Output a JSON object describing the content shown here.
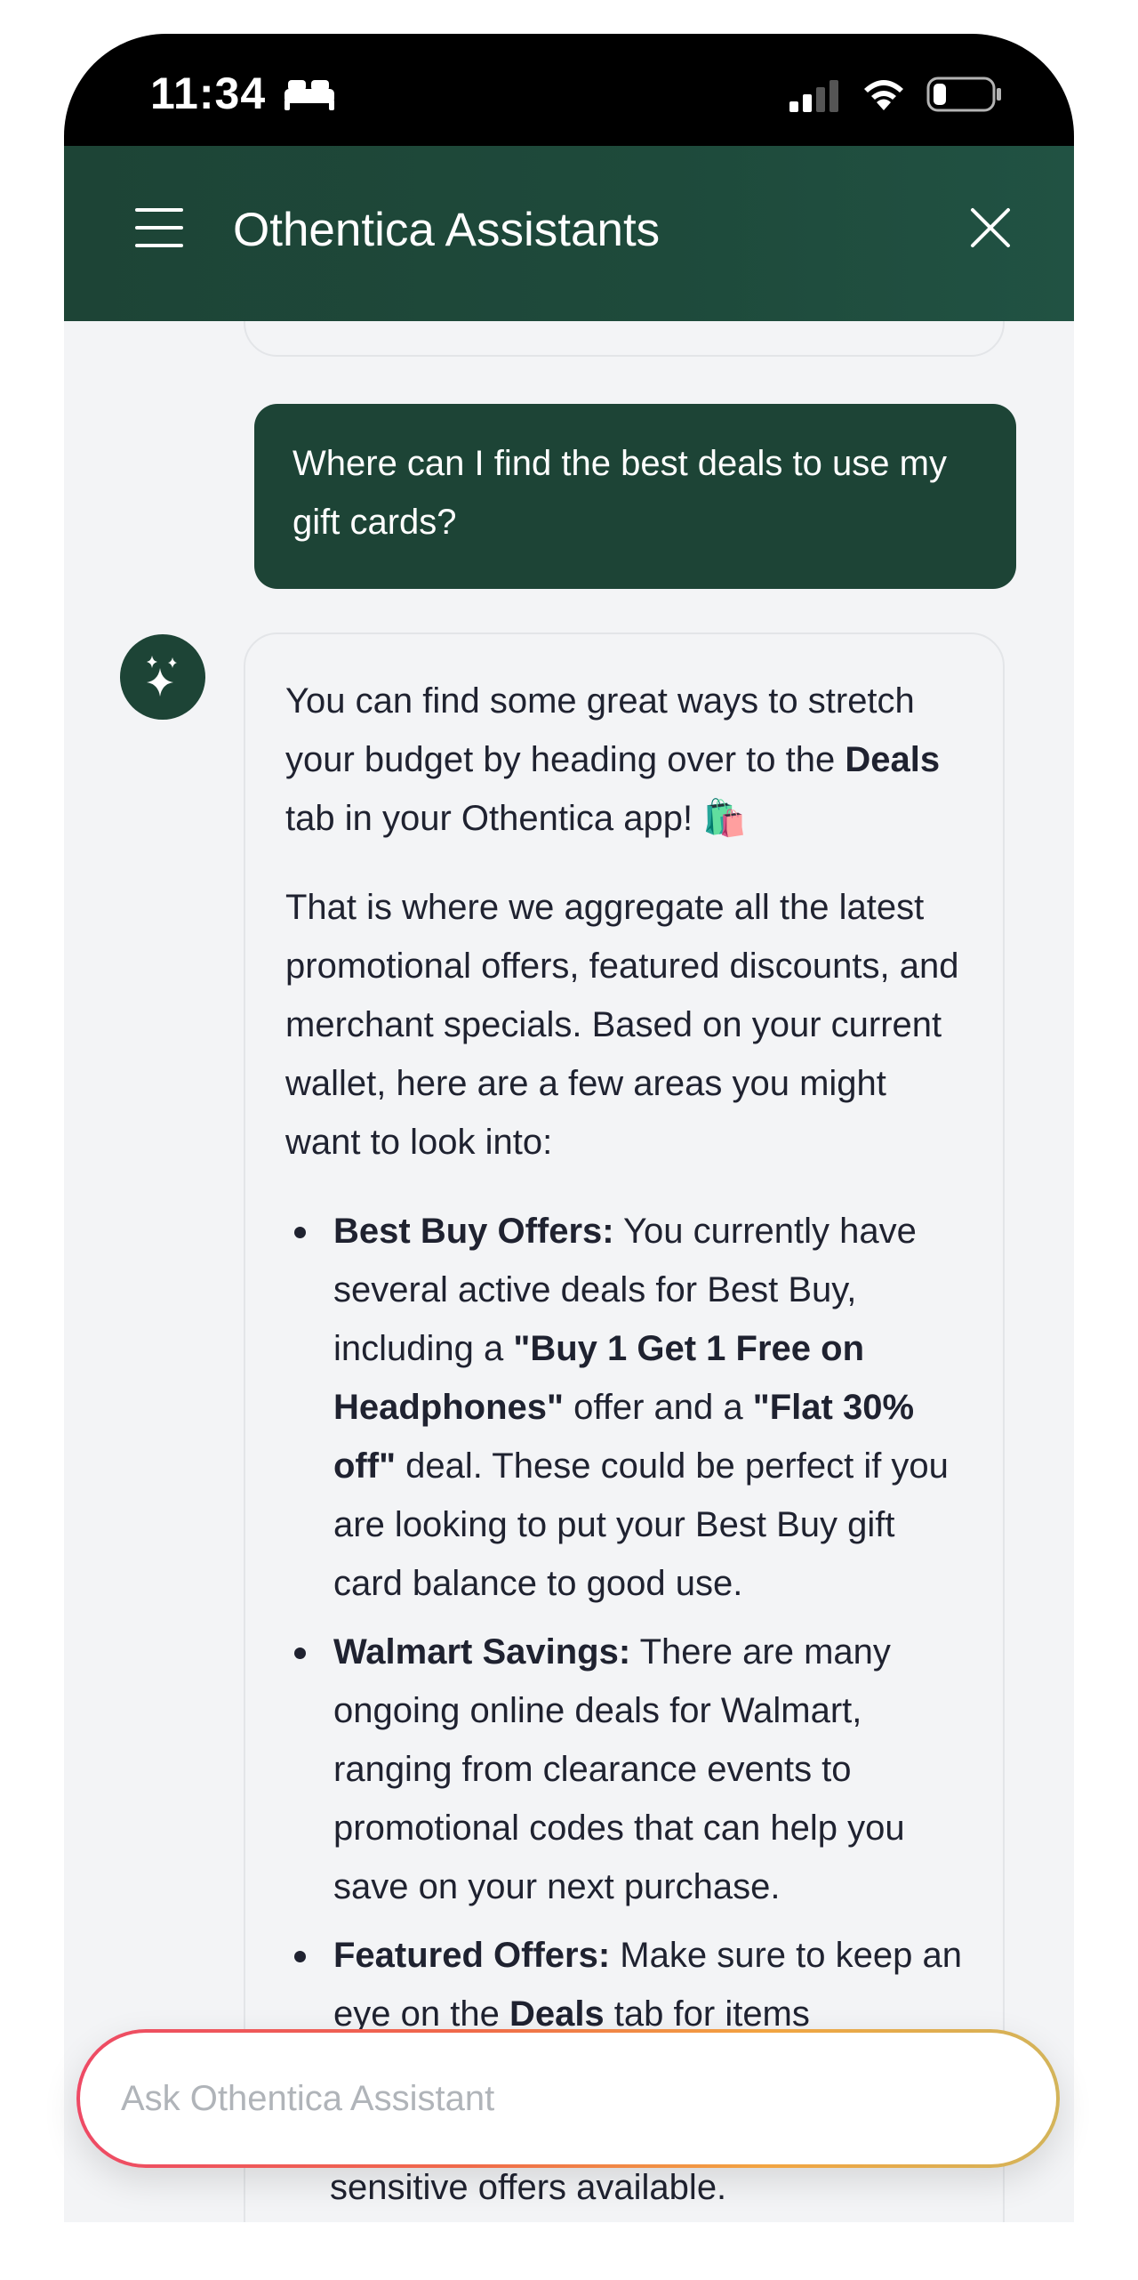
{
  "status_bar": {
    "time": "11:34",
    "icons": [
      "bed-icon",
      "signal-icon",
      "wifi-icon",
      "battery-icon"
    ]
  },
  "header": {
    "title": "Othentica Assistants",
    "menu_icon": "hamburger-menu-icon",
    "close_icon": "close-icon"
  },
  "colors": {
    "brand_green": "#1d4436",
    "bubble_bg": "#f3f4f6",
    "input_gradient_start": "#ee4a65",
    "input_gradient_end": "#d3b45a"
  },
  "messages": {
    "user": {
      "text": "Where can I find the best deals to use my gift cards?"
    },
    "assistant": {
      "avatar_icon": "sparkles-icon",
      "intro_part1": "You can find some great ways to stretch your budget by heading over to the ",
      "intro_bold": "Deals",
      "intro_part2": " tab in your Othentica app! ",
      "intro_emoji": "🛍️",
      "paragraph2": "That is where we aggregate all the latest promotional offers, featured discounts, and merchant specials. Based on your current wallet, here are a few areas you might want to look into:",
      "items": [
        {
          "title": "Best Buy Offers:",
          "text1": " You currently have several active deals for Best Buy, including a ",
          "bold1": "\"Buy 1 Get 1 Free on Headphones\"",
          "text2": " offer and a ",
          "bold2": "\"Flat 30% off\"",
          "text3": " deal. These could be perfect if you are looking to put your Best Buy gift card balance to good use."
        },
        {
          "title": "Walmart Savings:",
          "text1": " There are many ongoing online deals for Walmart, ranging from clearance events to promotional codes that can help you save on your next purchase."
        },
        {
          "title": "Featured Offers:",
          "text1": " Make sure to keep an eye on the ",
          "bold1": "Deals",
          "text2": " tab for items"
        }
      ],
      "trailing_visible_line": "sensitive offers available."
    }
  },
  "input": {
    "placeholder": "Ask Othentica Assistant",
    "value": ""
  }
}
